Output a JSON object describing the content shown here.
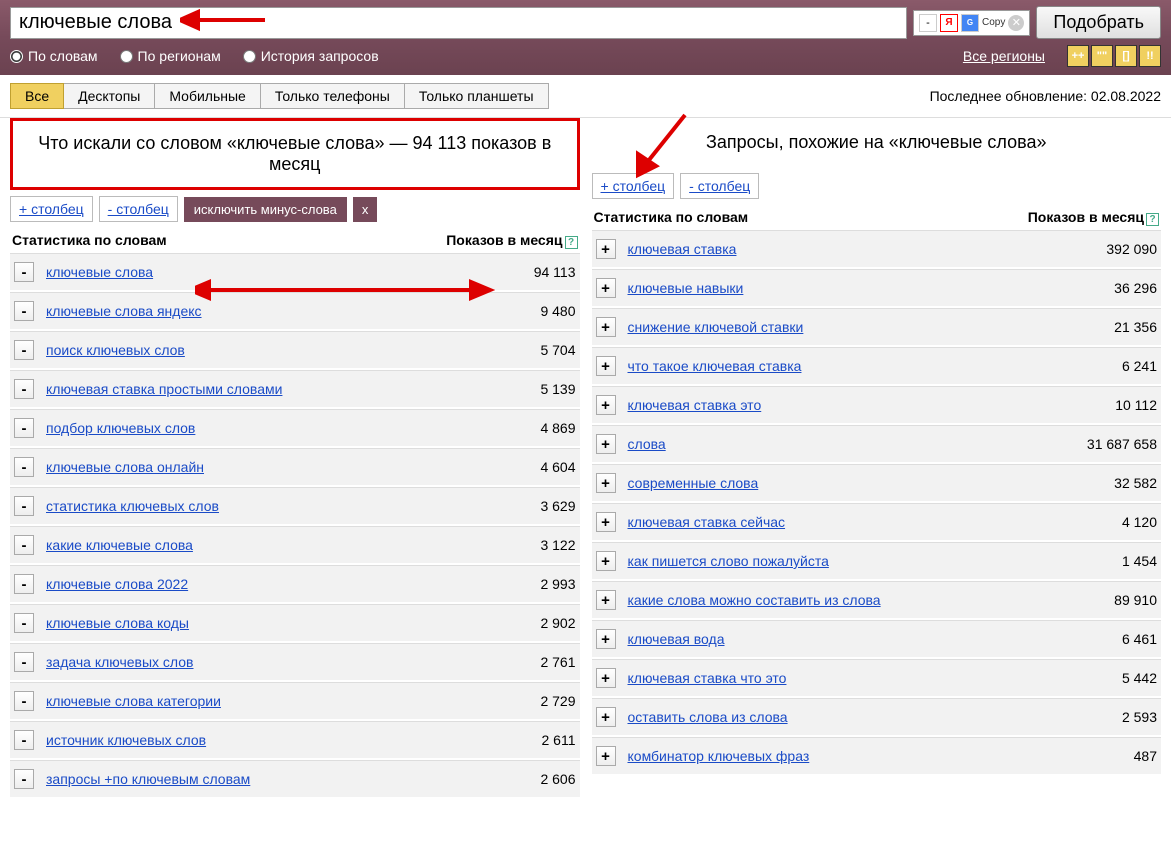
{
  "search": {
    "value": "ключевые слова",
    "submit": "Подобрать",
    "copy": "Copy"
  },
  "filters": {
    "by_words": "По словам",
    "by_regions": "По регионам",
    "history": "История запросов",
    "all_regions": "Все регионы"
  },
  "quote_buttons": [
    "++",
    "\"\"",
    "[]",
    "!!"
  ],
  "tabs": [
    "Все",
    "Десктопы",
    "Мобильные",
    "Только телефоны",
    "Только планшеты"
  ],
  "update_label": "Последнее обновление: 02.08.2022",
  "left": {
    "heading": "Что искали со словом «ключевые слова» — 94 113 показов в месяц",
    "add_col": "+ столбец",
    "rem_col": "- столбец",
    "exclude_minus": "исключить минус-слова",
    "x": "x",
    "th1": "Статистика по словам",
    "th2": "Показов в месяц",
    "rows": [
      {
        "q": "ключевые слова",
        "n": "94 113"
      },
      {
        "q": "ключевые слова яндекс",
        "n": "9 480"
      },
      {
        "q": "поиск ключевых слов",
        "n": "5 704"
      },
      {
        "q": "ключевая ставка простыми словами",
        "n": "5 139"
      },
      {
        "q": "подбор ключевых слов",
        "n": "4 869"
      },
      {
        "q": "ключевые слова онлайн",
        "n": "4 604"
      },
      {
        "q": "статистика ключевых слов",
        "n": "3 629"
      },
      {
        "q": "какие ключевые слова",
        "n": "3 122"
      },
      {
        "q": "ключевые слова 2022",
        "n": "2 993"
      },
      {
        "q": "ключевые слова коды",
        "n": "2 902"
      },
      {
        "q": "задача ключевых слов",
        "n": "2 761"
      },
      {
        "q": "ключевые слова категории",
        "n": "2 729"
      },
      {
        "q": "источник ключевых слов",
        "n": "2 611"
      },
      {
        "q": "запросы +по ключевым словам",
        "n": "2 606"
      }
    ]
  },
  "right": {
    "heading": "Запросы, похожие на «ключевые слова»",
    "add_col": "+ столбец",
    "rem_col": "- столбец",
    "th1": "Статистика по словам",
    "th2": "Показов в месяц",
    "rows": [
      {
        "q": "ключевая ставка",
        "n": "392 090"
      },
      {
        "q": "ключевые навыки",
        "n": "36 296"
      },
      {
        "q": "снижение ключевой ставки",
        "n": "21 356"
      },
      {
        "q": "что такое ключевая ставка",
        "n": "6 241"
      },
      {
        "q": "ключевая ставка это",
        "n": "10 112"
      },
      {
        "q": "слова",
        "n": "31 687 658"
      },
      {
        "q": "современные слова",
        "n": "32 582"
      },
      {
        "q": "ключевая ставка сейчас",
        "n": "4 120"
      },
      {
        "q": "как пишется слово пожалуйста",
        "n": "1 454"
      },
      {
        "q": "какие слова можно составить из слова",
        "n": "89 910"
      },
      {
        "q": "ключевая вода",
        "n": "6 461"
      },
      {
        "q": "ключевая ставка что это",
        "n": "5 442"
      },
      {
        "q": "оставить слова из слова",
        "n": "2 593"
      },
      {
        "q": "комбинатор ключевых фраз",
        "n": "487"
      }
    ]
  }
}
